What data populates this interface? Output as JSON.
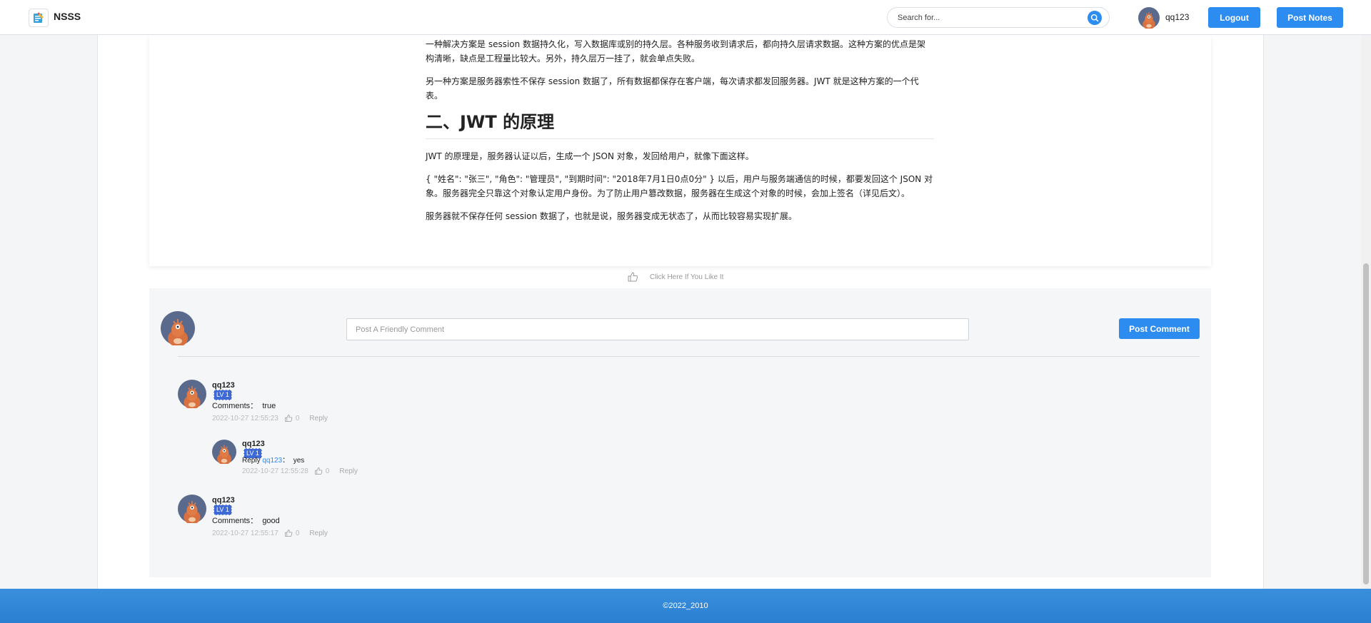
{
  "header": {
    "brand": "NSSS",
    "search_placeholder": "Search for...",
    "username": "qq123",
    "logout_label": "Logout",
    "post_notes_label": "Post Notes"
  },
  "article": {
    "p1": "一种解决方案是 session 数据持久化，写入数据库或别的持久层。各种服务收到请求后，都向持久层请求数据。这种方案的优点是架构清晰，缺点是工程量比较大。另外，持久层万一挂了，就会单点失败。",
    "p2": "另一种方案是服务器索性不保存 session 数据了，所有数据都保存在客户端，每次请求都发回服务器。JWT 就是这种方案的一个代表。",
    "heading": "二、JWT 的原理",
    "p3": "JWT 的原理是，服务器认证以后，生成一个 JSON 对象，发回给用户，就像下面这样。",
    "p4": "{ \"姓名\": \"张三\", \"角色\": \"管理员\", \"到期时间\": \"2018年7月1日0点0分\" } 以后，用户与服务端通信的时候，都要发回这个 JSON 对象。服务器完全只靠这个对象认定用户身份。为了防止用户篡改数据，服务器在生成这个对象的时候，会加上签名（详见后文）。",
    "p5": "服务器就不保存任何 session 数据了，也就是说，服务器变成无状态了，从而比较容易实现扩展。"
  },
  "like": {
    "label": "Click Here If You Like It"
  },
  "comment_form": {
    "placeholder": "Post A Friendly Comment",
    "submit_label": "Post Comment"
  },
  "comments": [
    {
      "user": "qq123",
      "level": "LV 1",
      "prefix": "Comments：",
      "text": "true",
      "time": "2022-10-27 12:55:23",
      "likes": "0",
      "reply_label": "Reply",
      "replies": [
        {
          "user": "qq123",
          "level": "LV 1",
          "prefix": "Reply",
          "mention": "qq123",
          "sep": "：",
          "text": "yes",
          "time": "2022-10-27 12:55:28",
          "likes": "0",
          "reply_label": "Reply"
        }
      ]
    },
    {
      "user": "qq123",
      "level": "LV 1",
      "prefix": "Comments：",
      "text": "good",
      "time": "2022-10-27 12:55:17",
      "likes": "0",
      "reply_label": "Reply",
      "replies": []
    }
  ],
  "footer": {
    "copyright": "©2022_2010"
  }
}
